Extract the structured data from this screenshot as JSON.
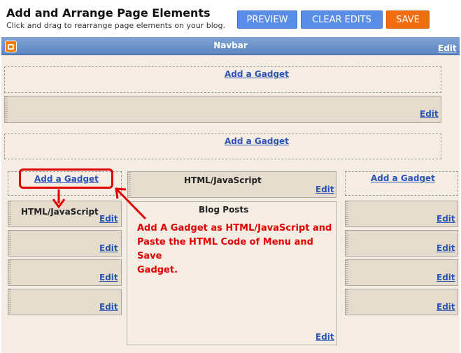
{
  "header": {
    "title": "Add and Arrange Page Elements",
    "subtitle": "Click and drag to rearrange page elements on your blog.",
    "preview_label": "PREVIEW",
    "clear_label": "CLEAR EDITS",
    "save_label": "SAVE"
  },
  "navbar": {
    "label": "Navbar",
    "edit": "Edit"
  },
  "top": {
    "gadget1": "Add a Gadget",
    "widget_edit": "Edit",
    "gadget2": "Add a Gadget"
  },
  "left": {
    "add_gadget": "Add a Gadget",
    "widget1_title": "HTML/JavaScript",
    "edit": "Edit"
  },
  "main": {
    "html_title": "HTML/JavaScript",
    "html_edit": "Edit",
    "blog_posts": "Blog Posts",
    "blog_edit": "Edit"
  },
  "right": {
    "add_gadget": "Add a Gadget",
    "edit": "Edit"
  },
  "annotation": {
    "lines": [
      "Add A Gadget  as HTML/JavaScript and",
      "Paste the HTML Code of Menu and Save",
      "Gadget."
    ]
  },
  "colors": {
    "annotation": "#e00000",
    "link": "#2a53b5",
    "save": "#f26c10",
    "button": "#5a8ee6"
  }
}
